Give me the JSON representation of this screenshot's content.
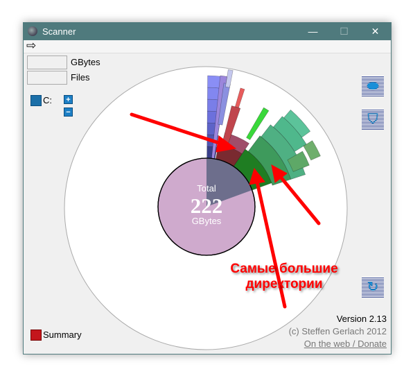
{
  "window": {
    "title": "Scanner",
    "minimize": "—",
    "maximize": "☐",
    "close": "✕"
  },
  "menu": {
    "back_icon": "⇨"
  },
  "stats": {
    "gbytes_value": "",
    "gbytes_label": "GBytes",
    "files_value": "",
    "files_label": "Files"
  },
  "drive": {
    "label": "C:",
    "expand": "+",
    "collapse": "−"
  },
  "chart": {
    "total_label": "Total",
    "total_value": "222",
    "unit": "GBytes"
  },
  "toolbar": {
    "drive_icon": "disk-icon",
    "trash_icon": "trash-icon",
    "refresh_icon": "refresh-icon"
  },
  "annotation": {
    "line1": "Самые большие",
    "line2": "директории",
    "color": "#ff0000"
  },
  "footer": {
    "version": "Version 2.13",
    "copyright": "(c) Steffen Gerlach 2012",
    "link": "On the web / Donate",
    "summary": "Summary"
  }
}
